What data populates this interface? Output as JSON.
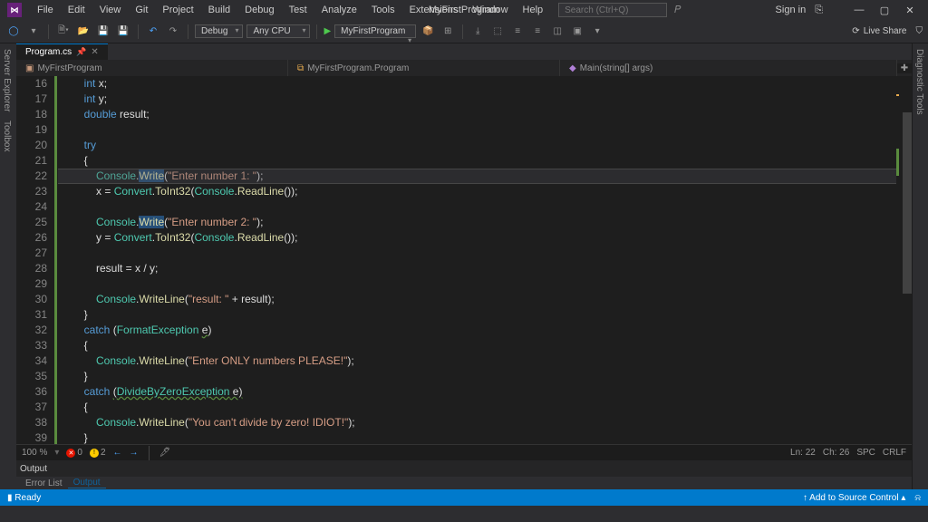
{
  "title": "MyFirstProgram",
  "menu": [
    "File",
    "Edit",
    "View",
    "Git",
    "Project",
    "Build",
    "Debug",
    "Test",
    "Analyze",
    "Tools",
    "Extensions",
    "Window",
    "Help"
  ],
  "search_placeholder": "Search (Ctrl+Q)",
  "signin": "Sign in",
  "toolbar": {
    "config": "Debug",
    "platform": "Any CPU",
    "start": "MyFirstProgram",
    "liveshare": "Live Share"
  },
  "sidepanels": {
    "left1": "Server Explorer",
    "left2": "Toolbox",
    "right": "Diagnostic Tools"
  },
  "tab": {
    "name": "Program.cs",
    "file_nav": "MyFirstProgram",
    "type_nav": "MyFirstProgram.Program",
    "member_nav": "Main(string[] args)"
  },
  "line_start": 16,
  "line_count": 26,
  "code": {
    "l16": "        int x;",
    "l17": "        int y;",
    "l18": "        double result;",
    "l20": "        try",
    "l21": "        {",
    "l22a": "            Console.",
    "l22b": "Write",
    "l22c": "(\"Enter number 1: \");",
    "l23": "            x = Convert.ToInt32(Console.ReadLine());",
    "l25a": "            Console.",
    "l25b": "Write",
    "l25c": "(\"Enter number 2: \");",
    "l26": "            y = Convert.ToInt32(Console.ReadLine());",
    "l28": "            result = x / y;",
    "l30": "            Console.WriteLine(\"result: \" + result);",
    "l31": "        }",
    "l32": "        catch (FormatException e)",
    "l33": "        {",
    "l34": "            Console.WriteLine(\"Enter ONLY numbers PLEASE!\");",
    "l35": "        }",
    "l36": "        catch (DivideByZeroException e)",
    "l37": "        {",
    "l38": "            Console.WriteLine(\"You can't divide by zero! IDIOT!\");",
    "l39": "        }"
  },
  "status": {
    "zoom": "100 %",
    "errors": "0",
    "warnings": "2",
    "ln": "Ln: 22",
    "ch": "Ch: 26",
    "spc": "SPC",
    "crlf": "CRLF"
  },
  "bottom_tabs": {
    "output": "Output",
    "errorlist": "Error List"
  },
  "bluebar": {
    "ready": "Ready",
    "source_control": "Add to Source Control"
  }
}
